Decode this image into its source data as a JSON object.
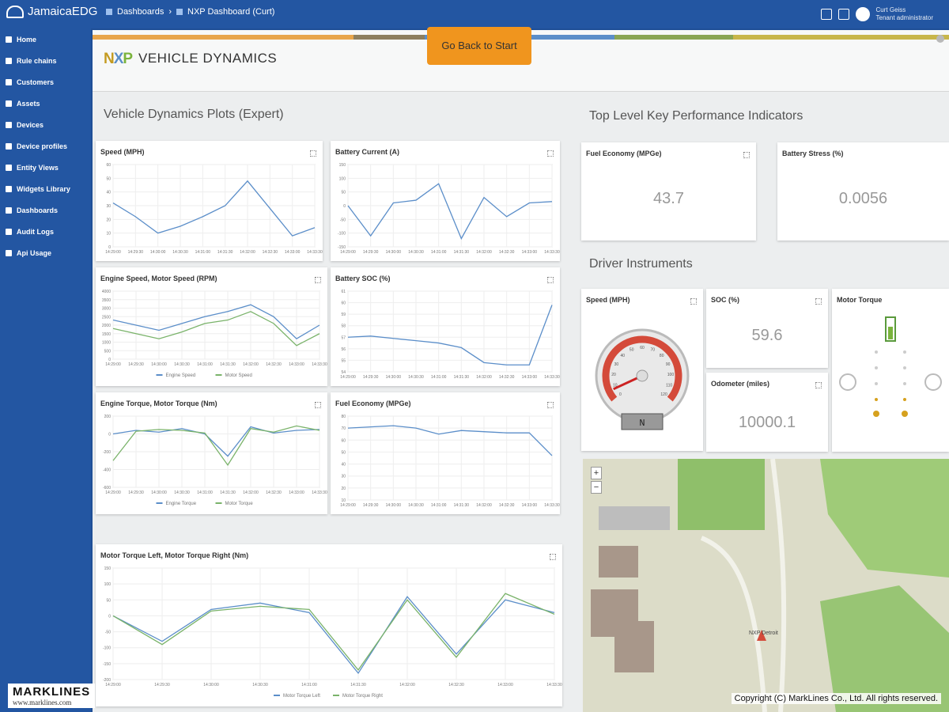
{
  "app": {
    "name": "JamaicaEDG"
  },
  "breadcrumb": {
    "first": "Dashboards",
    "second": "NXP Dashboard (Curt)"
  },
  "user": {
    "line1": "Curt Geiss",
    "line2": "Tenant administrator"
  },
  "sidebar": {
    "items": [
      {
        "label": "Home"
      },
      {
        "label": "Rule chains"
      },
      {
        "label": "Customers"
      },
      {
        "label": "Assets"
      },
      {
        "label": "Devices"
      },
      {
        "label": "Device profiles"
      },
      {
        "label": "Entity Views"
      },
      {
        "label": "Widgets Library"
      },
      {
        "label": "Dashboards"
      },
      {
        "label": "Audit Logs"
      },
      {
        "label": "Api Usage"
      }
    ]
  },
  "header": {
    "logo": "NXP",
    "title": "VEHICLE DYNAMICS",
    "back_button": "Go Back to Start",
    "stripe_colors": [
      "#e8a54b",
      "#8e7f5f",
      "#5b8ec9",
      "#8aa554",
      "#c8b64a"
    ]
  },
  "sections": {
    "plots": "Vehicle Dynamics Plots (Expert)",
    "kpi": "Top Level Key Performance Indicators",
    "driver": "Driver Instruments"
  },
  "panels": {
    "speed": "Speed (MPH)",
    "battery_current": "Battery Current (A)",
    "engine_speed": "Engine Speed, Motor Speed (RPM)",
    "battery_soc": "Battery SOC (%)",
    "engine_torque": "Engine Torque, Motor Torque (Nm)",
    "fuel_economy": "Fuel Economy (MPGe)",
    "motor_torque_lr": "Motor Torque Left, Motor Torque Right (Nm)"
  },
  "kpi": {
    "fuel_economy": {
      "label": "Fuel Economy (MPGe)",
      "value": "43.7"
    },
    "battery_stress": {
      "label": "Battery Stress (%)",
      "value": "0.0056"
    }
  },
  "instruments": {
    "speed": {
      "label": "Speed (MPH)",
      "gear": "N",
      "value": 7,
      "max": 120
    },
    "soc": {
      "label": "SOC (%)",
      "value": "59.6"
    },
    "odometer": {
      "label": "Odometer (miles)",
      "value": "10000.1"
    },
    "motor_torque": {
      "label": "Motor Torque"
    }
  },
  "colors": {
    "series_a": "#5b8ec9",
    "series_b": "#7ab36a",
    "gauge_red": "#d44a3a"
  },
  "chart_data": [
    {
      "id": "speed",
      "type": "line",
      "title": "Speed (MPH)",
      "ylim": [
        0,
        60
      ],
      "yticks": [
        0,
        10,
        20,
        30,
        40,
        50,
        60
      ],
      "categories": [
        "14:29:00",
        "14:29:30",
        "14:30:00",
        "14:30:30",
        "14:31:00",
        "14:31:30",
        "14:32:00",
        "14:32:30",
        "14:33:00",
        "14:33:30"
      ],
      "series": [
        {
          "values": [
            32,
            22,
            10,
            15,
            22,
            30,
            48,
            28,
            8,
            14
          ]
        }
      ]
    },
    {
      "id": "battery_current",
      "type": "line",
      "title": "Battery Current (A)",
      "ylim": [
        -150,
        150
      ],
      "yticks": [
        -150,
        -100,
        -50,
        0,
        50,
        100,
        150
      ],
      "categories": [
        "14:29:00",
        "14:29:30",
        "14:30:00",
        "14:30:30",
        "14:31:00",
        "14:31:30",
        "14:32:00",
        "14:32:30",
        "14:33:00",
        "14:33:30"
      ],
      "series": [
        {
          "values": [
            0,
            -110,
            10,
            20,
            80,
            -120,
            30,
            -40,
            10,
            15
          ]
        }
      ]
    },
    {
      "id": "engine_speed",
      "type": "line",
      "title": "Engine Speed, Motor Speed (RPM)",
      "ylim": [
        0,
        4000
      ],
      "yticks": [
        0,
        500,
        1000,
        1500,
        2000,
        2500,
        3000,
        3500,
        4000
      ],
      "categories": [
        "14:29:00",
        "14:29:30",
        "14:30:00",
        "14:30:30",
        "14:31:00",
        "14:31:30",
        "14:32:00",
        "14:32:30",
        "14:33:00",
        "14:33:30"
      ],
      "series": [
        {
          "name": "Engine Speed",
          "values": [
            2300,
            2000,
            1700,
            2100,
            2500,
            2800,
            3200,
            2500,
            1200,
            2000
          ]
        },
        {
          "name": "Motor Speed",
          "values": [
            1800,
            1500,
            1200,
            1600,
            2100,
            2300,
            2800,
            2100,
            800,
            1500
          ]
        }
      ]
    },
    {
      "id": "battery_soc",
      "type": "line",
      "title": "Battery SOC (%)",
      "ylim": [
        54,
        61
      ],
      "yticks": [
        54,
        55,
        56,
        57,
        58,
        59,
        60,
        61
      ],
      "categories": [
        "14:29:00",
        "14:29:30",
        "14:30:00",
        "14:30:30",
        "14:31:00",
        "14:31:30",
        "14:32:00",
        "14:32:30",
        "14:33:00",
        "14:33:30"
      ],
      "series": [
        {
          "values": [
            57,
            57.1,
            56.9,
            56.7,
            56.5,
            56.1,
            54.8,
            54.6,
            54.6,
            59.8
          ]
        }
      ]
    },
    {
      "id": "engine_torque",
      "type": "line",
      "title": "Engine Torque, Motor Torque (Nm)",
      "ylim": [
        -600,
        200
      ],
      "yticks": [
        -600,
        -400,
        -200,
        0,
        200
      ],
      "categories": [
        "14:29:00",
        "14:29:30",
        "14:30:00",
        "14:30:30",
        "14:31:00",
        "14:31:30",
        "14:32:00",
        "14:32:30",
        "14:33:00",
        "14:33:30"
      ],
      "series": [
        {
          "name": "Engine Torque",
          "values": [
            0,
            40,
            20,
            60,
            0,
            -250,
            80,
            10,
            40,
            50
          ]
        },
        {
          "name": "Motor Torque",
          "values": [
            -300,
            30,
            50,
            40,
            10,
            -350,
            60,
            20,
            90,
            40
          ]
        }
      ]
    },
    {
      "id": "fuel_economy",
      "type": "line",
      "title": "Fuel Economy (MPGe)",
      "ylim": [
        10,
        80
      ],
      "yticks": [
        10,
        20,
        30,
        40,
        50,
        60,
        70,
        80
      ],
      "categories": [
        "14:29:00",
        "14:29:30",
        "14:30:00",
        "14:30:30",
        "14:31:00",
        "14:31:30",
        "14:32:00",
        "14:32:30",
        "14:33:00",
        "14:33:30"
      ],
      "series": [
        {
          "values": [
            70,
            71,
            72,
            70,
            65,
            68,
            67,
            66,
            66,
            47
          ]
        }
      ]
    },
    {
      "id": "motor_torque_lr",
      "type": "line",
      "title": "Motor Torque Left, Motor Torque Right (Nm)",
      "ylim": [
        -200,
        150
      ],
      "yticks": [
        -200,
        -150,
        -100,
        -50,
        0,
        50,
        100,
        150
      ],
      "categories": [
        "14:29:00",
        "14:29:30",
        "14:30:00",
        "14:30:30",
        "14:31:00",
        "14:31:30",
        "14:32:00",
        "14:32:30",
        "14:33:00",
        "14:33:30"
      ],
      "series": [
        {
          "name": "Motor Torque Left",
          "values": [
            0,
            -80,
            20,
            40,
            10,
            -180,
            60,
            -120,
            50,
            10
          ]
        },
        {
          "name": "Motor Torque Right",
          "values": [
            0,
            -90,
            15,
            30,
            20,
            -170,
            50,
            -130,
            70,
            5
          ]
        }
      ]
    }
  ],
  "map": {
    "label": "NXP Detroit"
  },
  "footer": {
    "brand": "MARKLINES",
    "url": "www.marklines.com",
    "copyright": "Copyright (C) MarkLines Co., Ltd. All rights reserved."
  }
}
